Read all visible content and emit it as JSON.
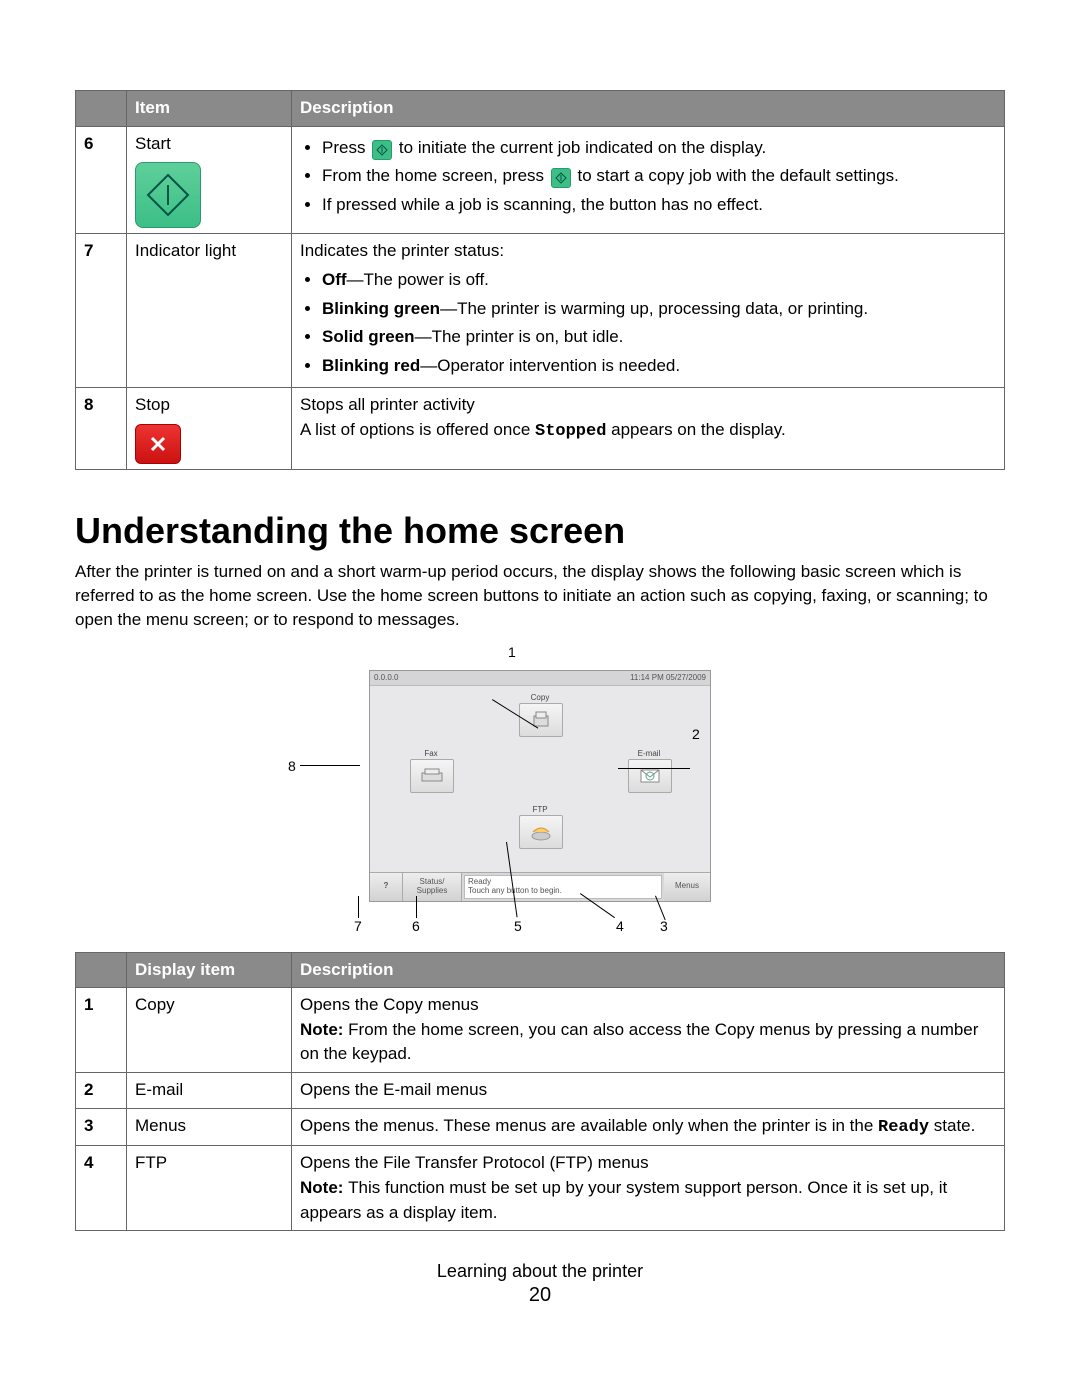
{
  "table1": {
    "head_item": "Item",
    "head_desc": "Description",
    "rows": [
      {
        "num": "6",
        "item": "Start",
        "desc": {
          "b1a": "Press ",
          "b1b": " to initiate the current job indicated on the display.",
          "b2a": "From the home screen, press ",
          "b2b": " to start a copy job with the default settings.",
          "b3": "If pressed while a job is scanning, the button has no effect."
        }
      },
      {
        "num": "7",
        "item": "Indicator light",
        "desc": {
          "intro": "Indicates the printer status:",
          "b1_bold": "Off",
          "b1_rest": "—The power is off.",
          "b2_bold": "Blinking green",
          "b2_rest": "—The printer is warming up, processing data, or printing.",
          "b3_bold": "Solid green",
          "b3_rest": "—The printer is on, but idle.",
          "b4_bold": "Blinking red",
          "b4_rest": "—Operator intervention is needed."
        }
      },
      {
        "num": "8",
        "item": "Stop",
        "desc": {
          "l1": "Stops all printer activity",
          "l2a": "A list of options is offered once ",
          "l2mono": "Stopped",
          "l2b": " appears on the display."
        }
      }
    ]
  },
  "heading": "Understanding the home screen",
  "intro": "After the printer is turned on and a short warm-up period occurs, the display shows the following basic screen which is referred to as the home screen. Use the home screen buttons to initiate an action such as copying, faxing, or scanning; to open the menu screen; or to respond to messages.",
  "diagram": {
    "top_left": "0.0.0.0",
    "top_right": "11:14 PM 05/27/2009",
    "copy": "Copy",
    "fax": "Fax",
    "email": "E-mail",
    "ftp": "FTP",
    "status_supplies": "Status/\nSupplies",
    "ready": "Ready",
    "touch_begin": "Touch any button to begin.",
    "menus": "Menus",
    "callouts": {
      "c1": "1",
      "c2": "2",
      "c3": "3",
      "c4": "4",
      "c5": "5",
      "c6": "6",
      "c7": "7",
      "c8": "8"
    }
  },
  "table2": {
    "head_item": "Display item",
    "head_desc": "Description",
    "rows": [
      {
        "num": "1",
        "item": "Copy",
        "l1": "Opens the Copy menus",
        "note_bold": "Note: ",
        "note_rest": "From the home screen, you can also access the Copy menus by pressing a number on the keypad."
      },
      {
        "num": "2",
        "item": "E-mail",
        "l1": "Opens the E-mail menus"
      },
      {
        "num": "3",
        "item": "Menus",
        "l1a": "Opens the menus. These menus are available only when the printer is in the ",
        "l1mono": "Ready",
        "l1b": " state."
      },
      {
        "num": "4",
        "item": "FTP",
        "l1": "Opens the File Transfer Protocol (FTP) menus",
        "note_bold": "Note: ",
        "note_rest": "This function must be set up by your system support person. Once it is set up, it appears as a display item."
      }
    ]
  },
  "footer": {
    "section": "Learning about the printer",
    "page": "20"
  }
}
